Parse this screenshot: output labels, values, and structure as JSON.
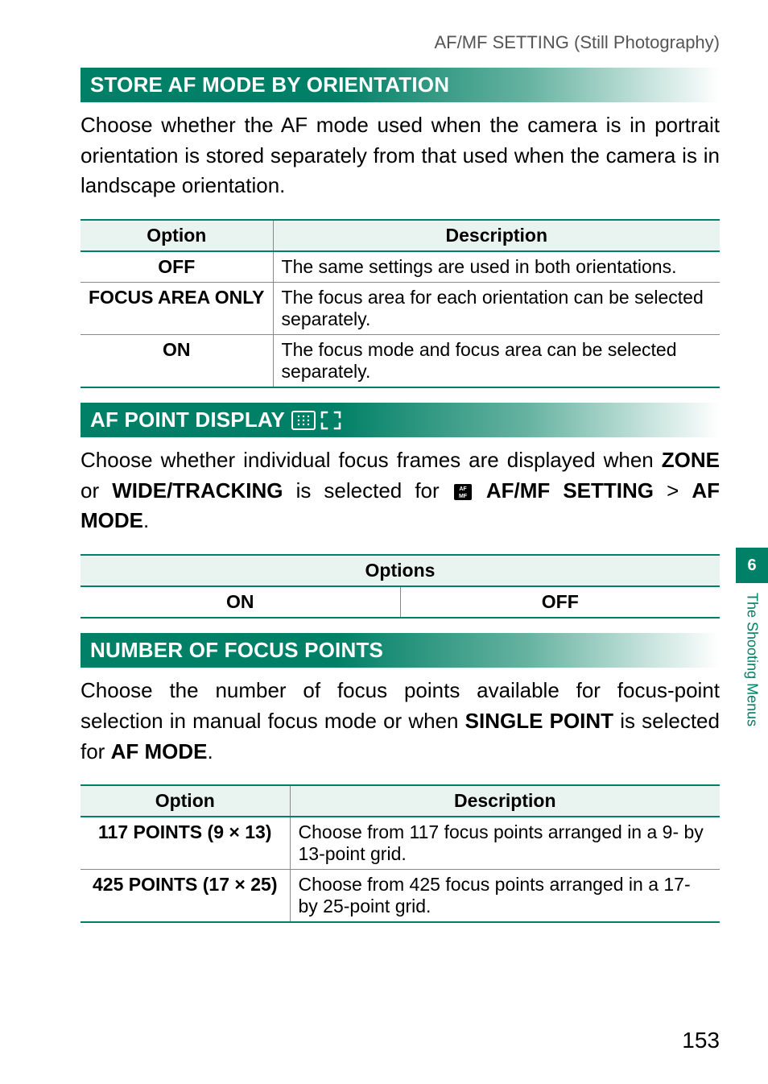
{
  "breadcrumb": "AF/MF SETTING (Still Photography)",
  "side_tab": {
    "number": "6",
    "label": "The Shooting Menus"
  },
  "page_number": "153",
  "sections": {
    "store_af": {
      "title": "STORE AF MODE BY ORIENTATION",
      "body": "Choose whether the AF mode used when the camera is in portrait orientation is stored separately from that used when the camera is in landscape orientation.",
      "columns": {
        "c1": "Option",
        "c2": "Description"
      },
      "rows": [
        {
          "opt": "OFF",
          "desc": "The same settings are used in both orientations."
        },
        {
          "opt": "FOCUS AREA ONLY",
          "desc": "The focus area for each orientation can be selected separately."
        },
        {
          "opt": "ON",
          "desc": "The focus mode and focus area can be selected separately."
        }
      ]
    },
    "af_point": {
      "title": "AF POINT DISPLAY",
      "body_pre": "Choose whether individual focus frames are displayed when ",
      "bold_zone": "ZONE",
      "or_text": " or ",
      "bold_wide": "WIDE/TRACKING",
      "mid": " is selected for ",
      "bold_setting": "AF/MF SETTING",
      "gt": " > ",
      "bold_mode": "AF MODE",
      "period": ".",
      "options_header": "Options",
      "options": {
        "on": "ON",
        "off": "OFF"
      }
    },
    "num_focus": {
      "title": "NUMBER OF FOCUS POINTS",
      "body_pre": "Choose the number of focus points available for focus-point selection in manual focus mode or when ",
      "bold_single": "SINGLE POINT",
      "mid": " is selected for ",
      "bold_mode": "AF MODE",
      "period": ".",
      "columns": {
        "c1": "Option",
        "c2": "Description"
      },
      "rows": [
        {
          "opt": "117 POINTS (9 × 13)",
          "desc": "Choose from 117 focus points arranged in a 9- by 13-point grid."
        },
        {
          "opt": "425 POINTS (17 × 25)",
          "desc": "Choose from 425 focus points arranged in a 17- by 25-point grid."
        }
      ]
    }
  }
}
